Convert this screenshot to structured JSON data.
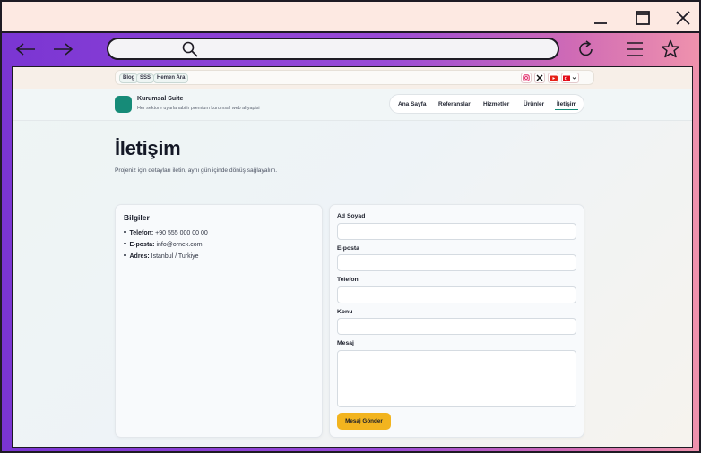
{
  "browser": {
    "address": {
      "value": "",
      "placeholder": ""
    },
    "icons": [
      "minimize-icon",
      "maximize-icon",
      "close-icon",
      "back-icon",
      "forward-icon",
      "search-icon",
      "reload-icon",
      "menu-icon",
      "star-icon"
    ]
  },
  "site": {
    "topbar": {
      "pills": [
        "Blog",
        "SSS",
        "Hemen Ara"
      ],
      "social_icons": [
        "instagram-icon",
        "x-icon",
        "youtube-icon",
        "language-flag-icon"
      ]
    },
    "brand": {
      "name": "Kurumsal Suite",
      "tagline": "Her sektore uyarlanabilir premium kurumsal web altyapisi",
      "logo_color": "#168b78"
    },
    "nav": [
      {
        "label": "Ana Sayfa"
      },
      {
        "label": "Referanslar"
      },
      {
        "label": "Hizmetler"
      },
      {
        "label": "Ürünler"
      },
      {
        "label": "İletişim",
        "active": true
      }
    ]
  },
  "page": {
    "title": "İletişim",
    "subtitle": "Projeniz için detayları iletin, aynı gün içinde dönüş sağlayalım."
  },
  "info": {
    "heading": "Bilgiler",
    "items": [
      {
        "label": "Telefon:",
        "value": "+90 555 000 00 00"
      },
      {
        "label": "E-posta:",
        "value": "info@ornek.com"
      },
      {
        "label": "Adres:",
        "value": "Istanbul / Turkiye"
      }
    ]
  },
  "form": {
    "fields": [
      {
        "label": "Ad Soyad",
        "value": ""
      },
      {
        "label": "E-posta",
        "value": ""
      },
      {
        "label": "Telefon",
        "value": ""
      },
      {
        "label": "Konu",
        "value": ""
      },
      {
        "label": "Mesaj",
        "value": ""
      }
    ],
    "submit_label": "Mesaj Gönder",
    "submit_color": "#f2b41f"
  },
  "colors": {
    "accent": "#168b78",
    "browser_gradient_start": "#7a35d3",
    "browser_gradient_end": "#ef92ad",
    "titlebar": "#fde9e2"
  }
}
